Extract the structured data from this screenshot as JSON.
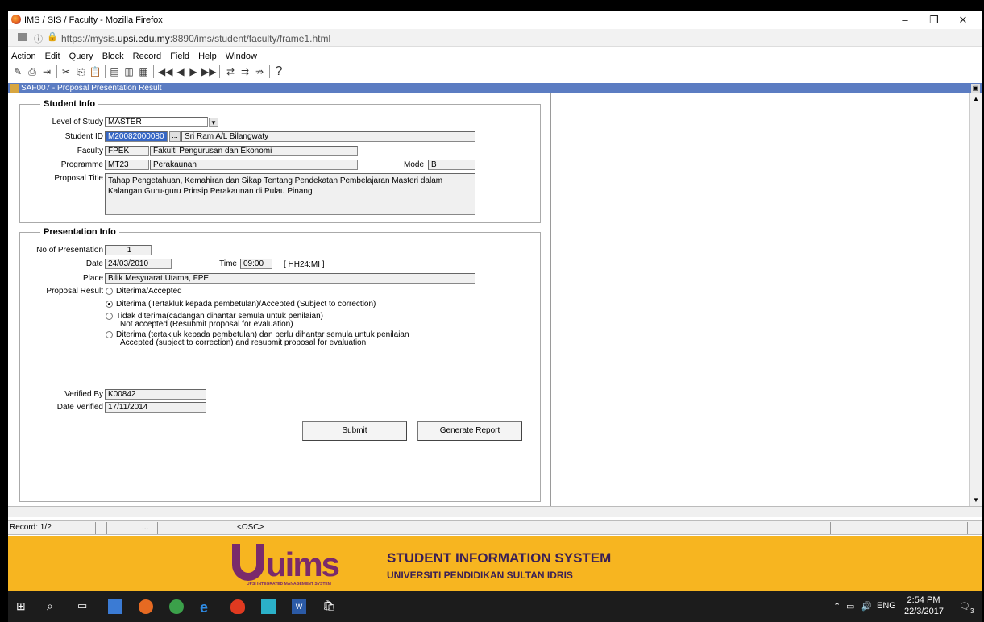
{
  "window": {
    "title": "IMS / SIS / Faculty - Mozilla Firefox",
    "url_prefix": "https://mysis.",
    "url_host": "upsi.edu.my",
    "url_suffix": ":8890/ims/student/faculty/frame1.html",
    "minimize": "–",
    "restore": "❐",
    "close": "✕"
  },
  "menu": [
    "Action",
    "Edit",
    "Query",
    "Block",
    "Record",
    "Field",
    "Help",
    "Window"
  ],
  "toolbar": {
    "help": "?"
  },
  "form": {
    "title": "SAF007 - Proposal Presentation Result",
    "max_glyph": "▣"
  },
  "student_info": {
    "group_title": "Student Info",
    "level_label": "Level of Study",
    "level_value": "MASTER",
    "student_id_label": "Student ID",
    "student_id_value": "M20082000080",
    "lov_button": "...",
    "student_name": "Sri Ram A/L Bilangwaty",
    "faculty_label": "Faculty",
    "faculty_code": "FPEK",
    "faculty_name": "Fakulti Pengurusan dan Ekonomi",
    "programme_label": "Programme",
    "programme_code": "MT23",
    "programme_name": "Perakaunan",
    "mode_label": "Mode",
    "mode_value": "B",
    "proposal_title_label": "Proposal Title",
    "proposal_title_value": "Tahap Pengetahuan, Kemahiran dan Sikap Tentang Pendekatan Pembelajaran Masteri dalam Kalangan Guru-guru Prinsip Perakaunan di Pulau Pinang"
  },
  "presentation_info": {
    "group_title": "Presentation Info",
    "no_label": "No of Presentation",
    "no_value": "1",
    "date_label": "Date",
    "date_value": "24/03/2010",
    "time_label": "Time",
    "time_value": "09:00",
    "time_format": "[ HH24:MI ]",
    "place_label": "Place",
    "place_value": "Bilik Mesyuarat Utama, FPE",
    "result_label": "Proposal Result",
    "results": [
      {
        "line1": "Diterima/Accepted",
        "line2": "",
        "selected": false
      },
      {
        "line1": "Diterima (Tertakluk kepada pembetulan)/Accepted (Subject to correction)",
        "line2": "",
        "selected": true
      },
      {
        "line1": "Tidak diterima(cadangan dihantar semula untuk penilaian)",
        "line2": "Not accepted (Resubmit proposal for evaluation)",
        "selected": false
      },
      {
        "line1": "Diterima (tertakluk kepada pembetulan) dan perlu dihantar semula untuk penilaian",
        "line2": "Accepted (subject to correction) and resubmit proposal for evaluation",
        "selected": false
      }
    ],
    "verified_by_label": "Verified By",
    "verified_by_value": "K00842",
    "date_verified_label": "Date Verified",
    "date_verified_value": "17/11/2014"
  },
  "buttons": {
    "submit": "Submit",
    "generate_report": "Generate Report"
  },
  "status": {
    "record": "Record: 1/?",
    "dots": "...",
    "osc": "<OSC>"
  },
  "banner": {
    "logo": "uims",
    "logo_sub": "UPSI INTEGRATED MANAGEMENT SYSTEM",
    "title": "STUDENT INFORMATION SYSTEM",
    "university": "UNIVERSITI PENDIDIKAN SULTAN IDRIS"
  },
  "taskbar": {
    "lang": "ENG",
    "time": "2:54 PM",
    "date": "22/3/2017",
    "notif_count": "3"
  },
  "colors": {
    "form_header": "#5b7cc2",
    "selection": "#3666c4",
    "banner": "#f7b520",
    "logo": "#7a2a6b"
  }
}
